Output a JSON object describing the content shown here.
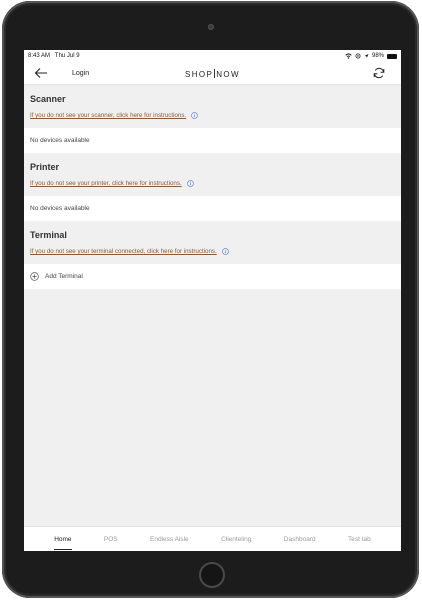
{
  "status_bar": {
    "time": "8:43 AM",
    "date": "Thu Jul 9",
    "battery": "98%",
    "battery_level": 0.98
  },
  "nav": {
    "back_icon": "arrow-left-icon",
    "link_label": "Login",
    "logo_left": "SHOP",
    "logo_right": "NOW",
    "refresh_icon": "refresh-icon"
  },
  "sections": [
    {
      "title": "Scanner",
      "instruction": "If you do not see your scanner, click here for instructions.",
      "row_text": "No devices available"
    },
    {
      "title": "Printer",
      "instruction": "If you do not see your printer, click here for instructions.",
      "row_text": "No devices available"
    },
    {
      "title": "Terminal",
      "instruction": "If you do not see your terminal connected, click here for instructions.",
      "row_text": "Add Terminal"
    }
  ],
  "tabs": [
    {
      "label": "Home",
      "active": true
    },
    {
      "label": "POS"
    },
    {
      "label": "Endless Aisle"
    },
    {
      "label": "Clienteling"
    },
    {
      "label": "Dashboard"
    },
    {
      "label": "Test tab"
    }
  ],
  "colors": {
    "link": "#8a5a3a",
    "info_icon": "#5b7fd6",
    "background": "#f0f0f0"
  }
}
